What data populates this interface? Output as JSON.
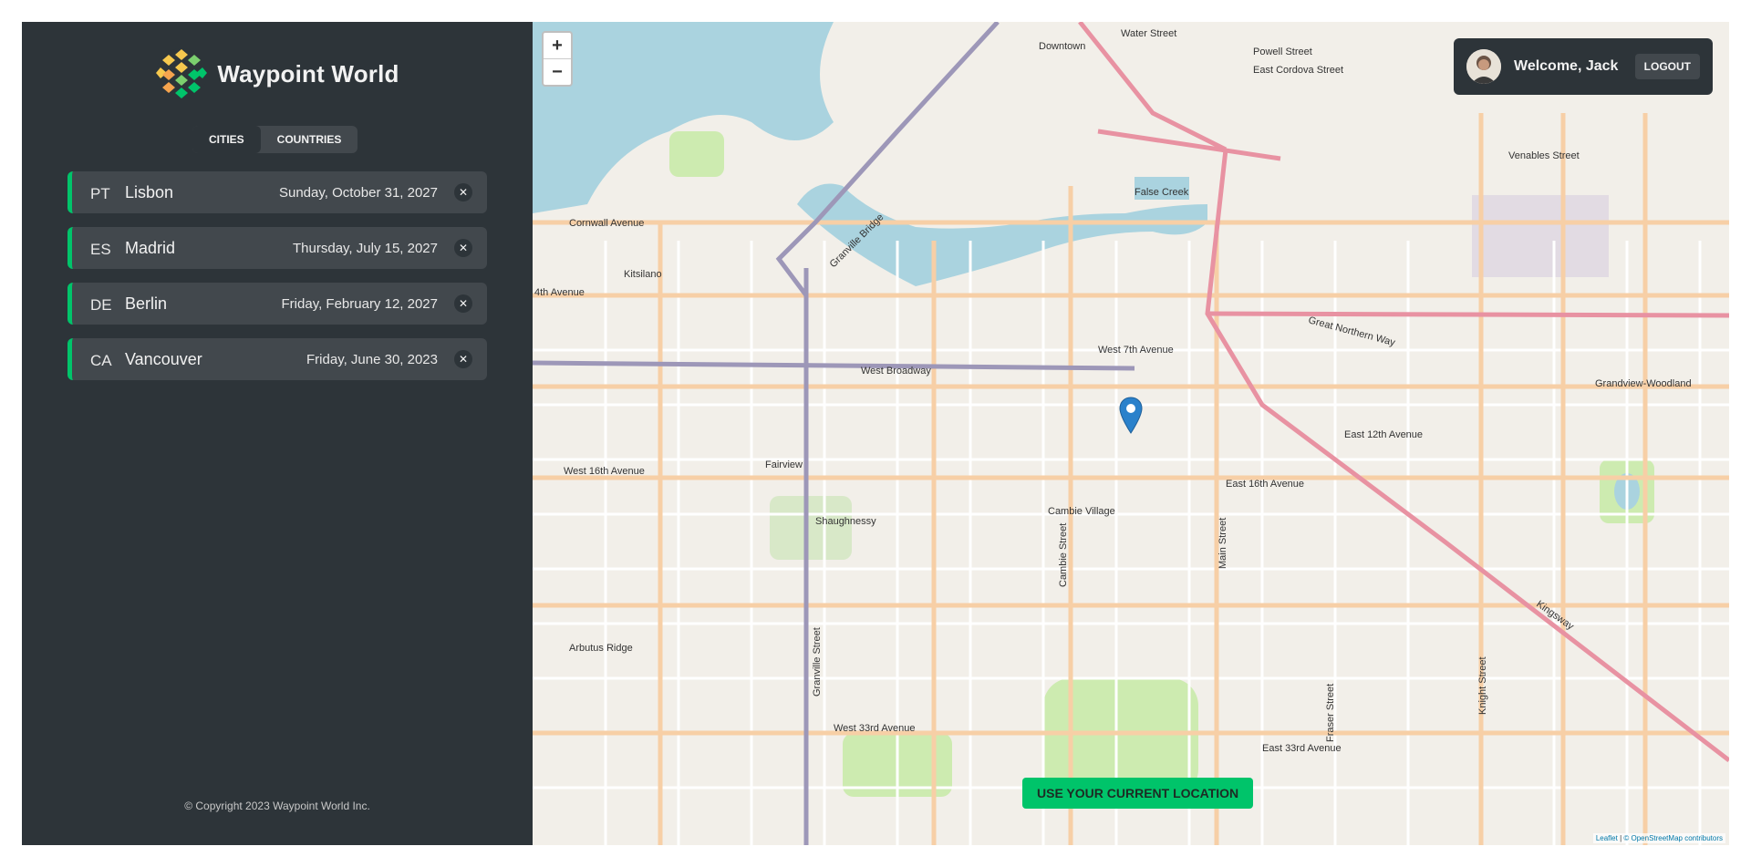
{
  "app": {
    "name": "Waypoint World",
    "copyright": "© Copyright 2023 Waypoint World Inc."
  },
  "tabs": [
    {
      "label": "CITIES",
      "active": true
    },
    {
      "label": "COUNTRIES",
      "active": false
    }
  ],
  "cities": [
    {
      "code": "PT",
      "name": "Lisbon",
      "date": "Sunday, October 31, 2027"
    },
    {
      "code": "ES",
      "name": "Madrid",
      "date": "Thursday, July 15, 2027"
    },
    {
      "code": "DE",
      "name": "Berlin",
      "date": "Friday, February 12, 2027"
    },
    {
      "code": "CA",
      "name": "Vancouver",
      "date": "Friday, June 30, 2023"
    }
  ],
  "map": {
    "zoom_in": "+",
    "zoom_out": "−",
    "cta": "USE YOUR CURRENT LOCATION",
    "attribution_leaflet": "Leaflet",
    "attribution_osm": "© OpenStreetMap contributors",
    "labels": [
      "Downtown",
      "False Creek",
      "Kitsilano",
      "Shaughnessy",
      "Fairview",
      "West Broadway",
      "West 7th Avenue",
      "East 12th Avenue",
      "West 16th Avenue",
      "East 16th Avenue",
      "West 33rd Avenue",
      "East 33rd Avenue",
      "Granville Street",
      "Cambie Street",
      "Main Street",
      "Fraser Street",
      "Knight Street",
      "Kingsway",
      "Cornwall Avenue",
      "4th Avenue",
      "Great Northern Way",
      "Grandview-Woodland",
      "Arbutus Ridge",
      "Water Street",
      "Powell Street",
      "East Cordova Street",
      "Venables Street",
      "Granville Bridge",
      "Cambie Village"
    ],
    "colors": {
      "water": "#aad3df",
      "land": "#f2efe9",
      "park": "#cdebb0",
      "road": "#f7cfa6",
      "highway": "#e892a2",
      "rail": "#9d97b8"
    }
  },
  "user": {
    "welcome": "Welcome, Jack",
    "logout": "LOGOUT"
  },
  "colors": {
    "accent": "#00c46a",
    "panel": "#2d3439",
    "panel_light": "#42484d"
  }
}
